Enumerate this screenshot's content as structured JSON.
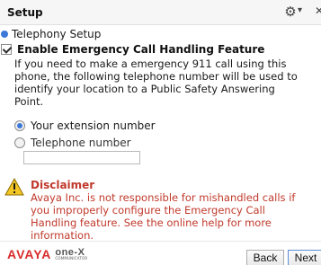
{
  "header": {
    "title": "Setup"
  },
  "section": {
    "label": "Telephony Setup"
  },
  "feature": {
    "label": "Enable Emergency Call Handling Feature"
  },
  "description": "If you need to make a emergency 911 call using this phone, the following telephone number will be used to identify your location to a Public Safety Answering Point.",
  "options": {
    "extension": "Your extension number",
    "telephone": "Telephone number",
    "telephone_value": ""
  },
  "disclaimer": {
    "title": "Disclaimer",
    "text": "Avaya Inc. is not responsible for mishandled calls if you improperly configure the Emergency Call Handling feature. See the online help for more information."
  },
  "brand": {
    "name": "AVAYA",
    "product": "one-X",
    "product_sub": "COMMUNICATOR"
  },
  "buttons": {
    "back": "Back",
    "next": "Next"
  },
  "colors": {
    "accent": "#3b78d8",
    "warning_text": "#c0392b",
    "brand_red": "#d92b2b"
  }
}
